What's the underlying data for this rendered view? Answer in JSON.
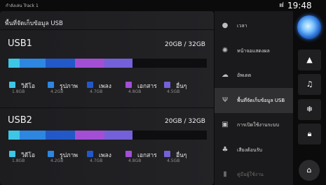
{
  "status": {
    "source": "กำลังเล่น Track 1",
    "signal": "ıııl",
    "time": "19:48"
  },
  "page": {
    "title": "พื้นที่จัดเก็บข้อมูล USB"
  },
  "devices": [
    {
      "name": "USB1",
      "capacity": "20GB / 32GB",
      "segments": [
        {
          "label": "วิดีโอ",
          "size": "1.8GB",
          "color": "#3ec6e6",
          "fraction": 0.056
        },
        {
          "label": "รูปภาพ",
          "size": "4.2GB",
          "color": "#2d86e0",
          "fraction": 0.131
        },
        {
          "label": "เพลง",
          "size": "4.7GB",
          "color": "#2358c8",
          "fraction": 0.147
        },
        {
          "label": "เอกสาร",
          "size": "4.8GB",
          "color": "#a24fd6",
          "fraction": 0.15
        },
        {
          "label": "อื่นๆ",
          "size": "4.5GB",
          "color": "#7460d8",
          "fraction": 0.141
        }
      ]
    },
    {
      "name": "USB2",
      "capacity": "20GB / 32GB",
      "segments": [
        {
          "label": "วิดีโอ",
          "size": "1.8GB",
          "color": "#3ec6e6",
          "fraction": 0.056
        },
        {
          "label": "รูปภาพ",
          "size": "4.2GB",
          "color": "#2d86e0",
          "fraction": 0.131
        },
        {
          "label": "เพลง",
          "size": "4.7GB",
          "color": "#2358c8",
          "fraction": 0.147
        },
        {
          "label": "เอกสาร",
          "size": "4.8GB",
          "color": "#a24fd6",
          "fraction": 0.15
        },
        {
          "label": "อื่นๆ",
          "size": "4.5GB",
          "color": "#7460d8",
          "fraction": 0.141
        }
      ]
    }
  ],
  "menu": [
    {
      "label": "เวลา",
      "icon": "clock-icon",
      "glyph": "●"
    },
    {
      "label": "หน้าจอแสดงผล",
      "icon": "brightness-icon",
      "glyph": "✺"
    },
    {
      "label": "อัพเดต",
      "icon": "cloud-update-icon",
      "glyph": "☁"
    },
    {
      "label": "พื้นที่จัดเก็บข้อมูล USB",
      "icon": "usb-icon",
      "glyph": "Ψ",
      "active": true
    },
    {
      "label": "การเปิดใช้งานระบบ",
      "icon": "system-icon",
      "glyph": "▣"
    },
    {
      "label": "เสียงต้อนรับ",
      "icon": "welcome-sound-icon",
      "glyph": "♣"
    },
    {
      "label": "คู่มือผู้ใช้งาน",
      "icon": "manual-icon",
      "glyph": "▮",
      "faded": true
    }
  ],
  "rail": [
    {
      "icon": "navigation-arrow-icon",
      "glyph": "▲"
    },
    {
      "icon": "music-icon",
      "glyph": "♫"
    },
    {
      "icon": "climate-fan-icon",
      "glyph": "❄"
    },
    {
      "icon": "lock-icon",
      "glyph": "🔒︎"
    }
  ],
  "home": {
    "icon": "home-icon",
    "glyph": "⌂"
  },
  "assistant": {
    "icon": "assistant-orb-icon"
  }
}
